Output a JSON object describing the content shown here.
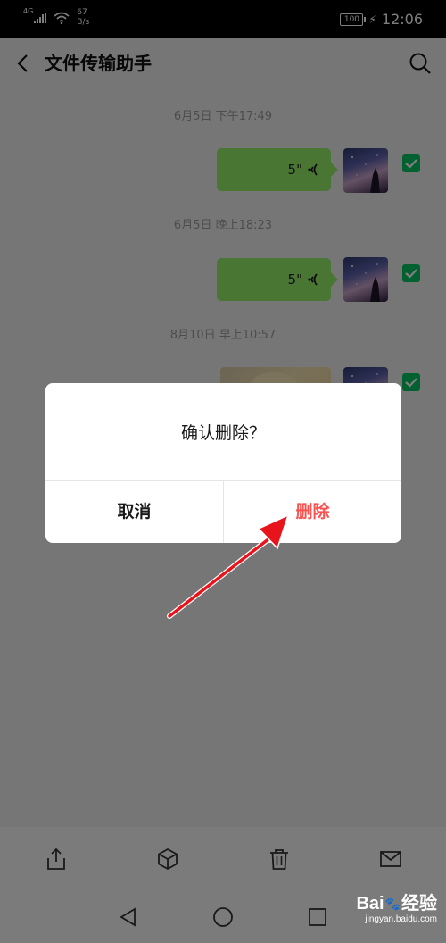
{
  "status_bar": {
    "network": "4G",
    "speed_value": "67",
    "speed_unit": "B/s",
    "battery": "100",
    "time": "12:06"
  },
  "header": {
    "title": "文件传输助手",
    "back_icon": "chevron-left-icon",
    "search_icon": "search-icon"
  },
  "messages": [
    {
      "timestamp": "6月5日 下午17:49",
      "type": "voice",
      "duration": "5\"",
      "selected": true
    },
    {
      "timestamp": "6月5日 晚上18:23",
      "type": "voice",
      "duration": "5\"",
      "selected": true
    },
    {
      "timestamp": "8月10日 早上10:57",
      "type": "image",
      "selected": true
    }
  ],
  "dialog": {
    "message": "确认删除？",
    "cancel_label": "取消",
    "confirm_label": "删除"
  },
  "toolbar": {
    "icons": [
      "share-icon",
      "box-icon",
      "trash-icon",
      "mail-icon"
    ]
  },
  "system_nav": {
    "icons": [
      "back-triangle-icon",
      "home-circle-icon",
      "recents-square-icon"
    ]
  },
  "watermark": {
    "brand_left": "Bai",
    "brand_right": "经验",
    "url": "jingyan.baidu.com"
  },
  "colors": {
    "bubble_green": "#95ec69",
    "check_green": "#07c160",
    "delete_red": "#fa5151",
    "overlay": "rgba(0,0,0,0.5)"
  }
}
